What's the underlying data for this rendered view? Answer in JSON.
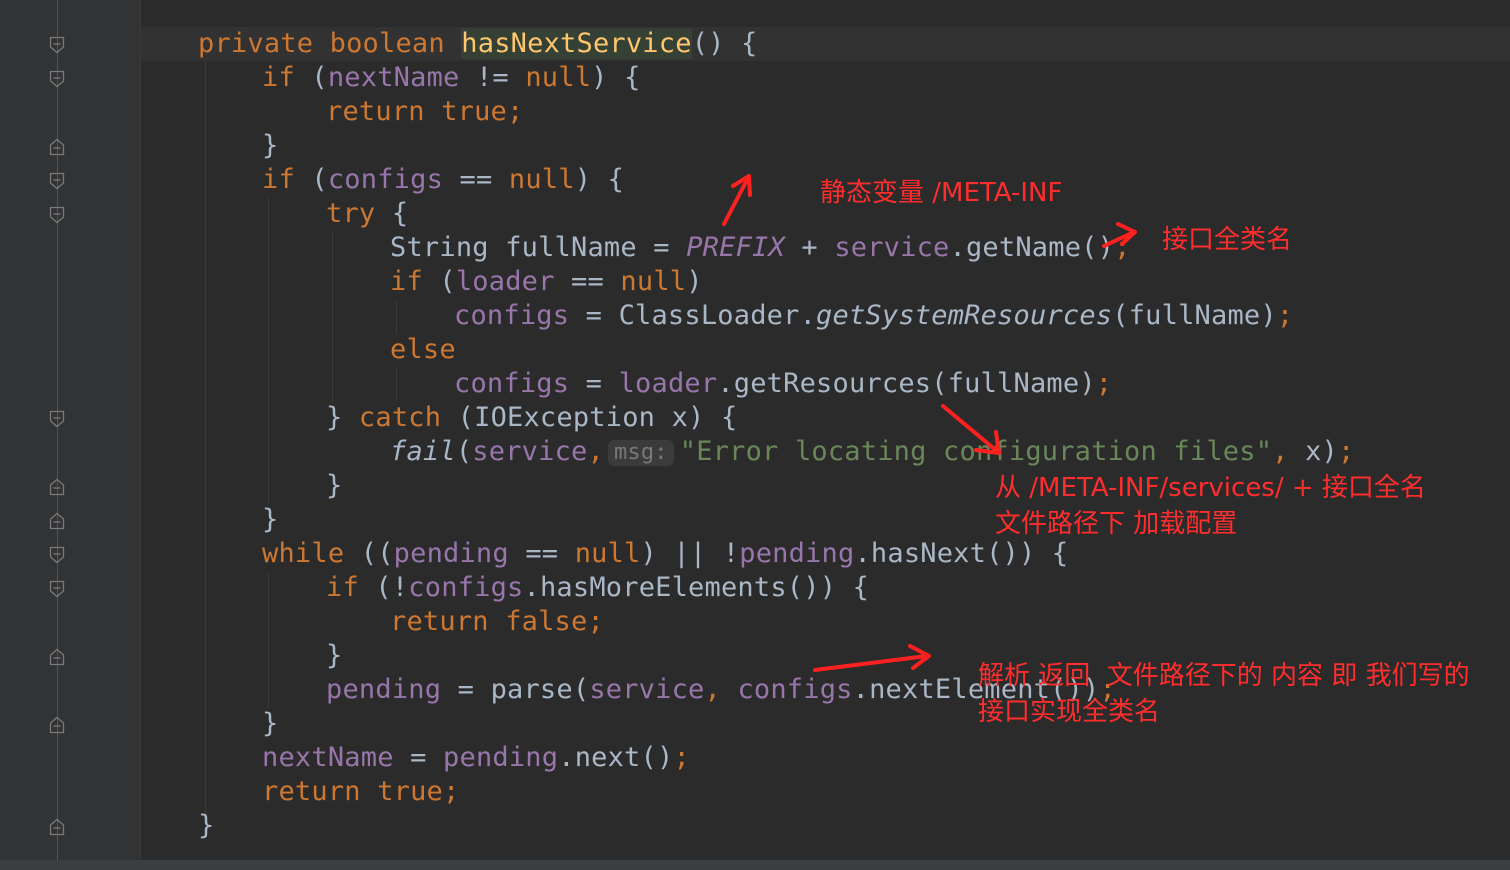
{
  "code": {
    "l1_kw": "private boolean ",
    "l1_name": "hasNextService",
    "l1_rest": "() {",
    "l2_kw": "if",
    "l2_a": " (",
    "l2_f": "nextName",
    "l2_b": " != ",
    "l2_null": "null",
    "l2_c": ") {",
    "l3_kw": "return true",
    "l3_semi": ";",
    "l4": "}",
    "l5_kw": "if",
    "l5_a": " (",
    "l5_f": "configs",
    "l5_b": " == ",
    "l5_null": "null",
    "l5_c": ") {",
    "l6_kw": "try",
    "l6_rest": " {",
    "l7_a": "String fullName = ",
    "l7_const": "PREFIX",
    "l7_b": " + ",
    "l7_f": "service",
    "l7_c": ".getName()",
    "l7_semi": ";",
    "l8_kw": "if",
    "l8_a": " (",
    "l8_f": "loader",
    "l8_b": " == ",
    "l8_null": "null",
    "l8_c": ")",
    "l9_f": "configs",
    "l9_a": " = ClassLoader.",
    "l9_m": "getSystemResources",
    "l9_b": "(fullName)",
    "l9_semi": ";",
    "l10_kw": "else",
    "l11_f": "configs",
    "l11_a": " = ",
    "l11_f2": "loader",
    "l11_b": ".getResources(fullName)",
    "l11_semi": ";",
    "l12_a": "} ",
    "l12_kw": "catch",
    "l12_b": " (IOException x) {",
    "l13_m": "fail",
    "l13_a": "(",
    "l13_f": "service",
    "l13_comma": ",",
    "l13_hint": "msg:",
    "l13_str": "\"Error locating configuration files\"",
    "l13_comma2": ",",
    "l13_b": " x)",
    "l13_semi": ";",
    "l14": "}",
    "l15": "}",
    "l16_kw": "while",
    "l16_a": " ((",
    "l16_f": "pending",
    "l16_b": " == ",
    "l16_null": "null",
    "l16_c": ") || !",
    "l16_f2": "pending",
    "l16_d": ".hasNext()) {",
    "l17_kw": "if",
    "l17_a": " (!",
    "l17_f": "configs",
    "l17_b": ".hasMoreElements()) {",
    "l18_kw": "return false",
    "l18_semi": ";",
    "l19": "}",
    "l20_f": "pending",
    "l20_a": " = parse(",
    "l20_f2": "service",
    "l20_comma": ", ",
    "l20_f3": "configs",
    "l20_b": ".nextElement())",
    "l20_semi": ";",
    "l21": "}",
    "l22_f": "nextName",
    "l22_a": " = ",
    "l22_f2": "pending",
    "l22_b": ".next()",
    "l22_semi": ";",
    "l23_kw": "return true",
    "l23_semi": ";",
    "l24": "}"
  },
  "annotations": {
    "static_var": "静态变量 /META-INF",
    "interface_name": "接口全类名",
    "load_config_line1": "从 /META-INF/services/ + 接口全名",
    "load_config_line2": "文件路径下 加载配置",
    "parse_line1": "解析 返回  文件路径下的 内容 即 我们写的",
    "parse_line2": "接口实现全类名"
  },
  "colors": {
    "background": "#2b2b2b",
    "keyword": "#cc7832",
    "field": "#9876aa",
    "method_declaration": "#ffc66d",
    "string": "#6a8759",
    "text": "#a9b7c6",
    "annotation": "#ff2d2d"
  }
}
